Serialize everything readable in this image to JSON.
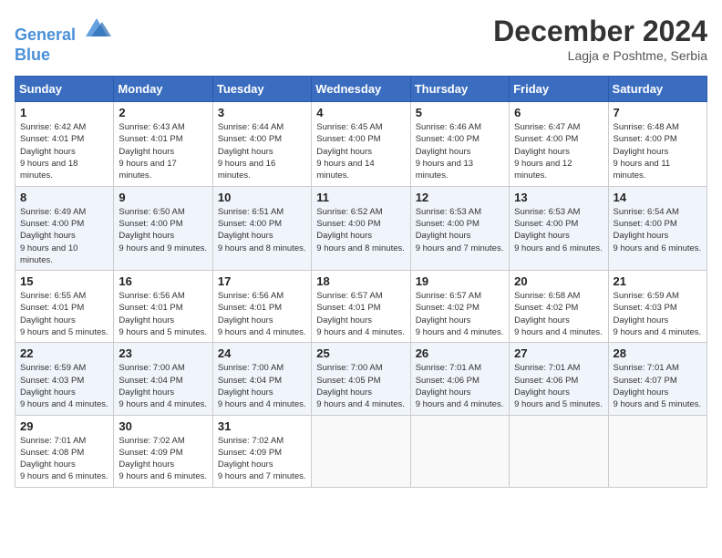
{
  "header": {
    "logo_line1": "General",
    "logo_line2": "Blue",
    "month_year": "December 2024",
    "location": "Lagja e Poshtme, Serbia"
  },
  "weekdays": [
    "Sunday",
    "Monday",
    "Tuesday",
    "Wednesday",
    "Thursday",
    "Friday",
    "Saturday"
  ],
  "weeks": [
    [
      {
        "day": "1",
        "sunrise": "6:42 AM",
        "sunset": "4:01 PM",
        "daylight": "9 hours and 18 minutes."
      },
      {
        "day": "2",
        "sunrise": "6:43 AM",
        "sunset": "4:01 PM",
        "daylight": "9 hours and 17 minutes."
      },
      {
        "day": "3",
        "sunrise": "6:44 AM",
        "sunset": "4:00 PM",
        "daylight": "9 hours and 16 minutes."
      },
      {
        "day": "4",
        "sunrise": "6:45 AM",
        "sunset": "4:00 PM",
        "daylight": "9 hours and 14 minutes."
      },
      {
        "day": "5",
        "sunrise": "6:46 AM",
        "sunset": "4:00 PM",
        "daylight": "9 hours and 13 minutes."
      },
      {
        "day": "6",
        "sunrise": "6:47 AM",
        "sunset": "4:00 PM",
        "daylight": "9 hours and 12 minutes."
      },
      {
        "day": "7",
        "sunrise": "6:48 AM",
        "sunset": "4:00 PM",
        "daylight": "9 hours and 11 minutes."
      }
    ],
    [
      {
        "day": "8",
        "sunrise": "6:49 AM",
        "sunset": "4:00 PM",
        "daylight": "9 hours and 10 minutes."
      },
      {
        "day": "9",
        "sunrise": "6:50 AM",
        "sunset": "4:00 PM",
        "daylight": "9 hours and 9 minutes."
      },
      {
        "day": "10",
        "sunrise": "6:51 AM",
        "sunset": "4:00 PM",
        "daylight": "9 hours and 8 minutes."
      },
      {
        "day": "11",
        "sunrise": "6:52 AM",
        "sunset": "4:00 PM",
        "daylight": "9 hours and 8 minutes."
      },
      {
        "day": "12",
        "sunrise": "6:53 AM",
        "sunset": "4:00 PM",
        "daylight": "9 hours and 7 minutes."
      },
      {
        "day": "13",
        "sunrise": "6:53 AM",
        "sunset": "4:00 PM",
        "daylight": "9 hours and 6 minutes."
      },
      {
        "day": "14",
        "sunrise": "6:54 AM",
        "sunset": "4:00 PM",
        "daylight": "9 hours and 6 minutes."
      }
    ],
    [
      {
        "day": "15",
        "sunrise": "6:55 AM",
        "sunset": "4:01 PM",
        "daylight": "9 hours and 5 minutes."
      },
      {
        "day": "16",
        "sunrise": "6:56 AM",
        "sunset": "4:01 PM",
        "daylight": "9 hours and 5 minutes."
      },
      {
        "day": "17",
        "sunrise": "6:56 AM",
        "sunset": "4:01 PM",
        "daylight": "9 hours and 4 minutes."
      },
      {
        "day": "18",
        "sunrise": "6:57 AM",
        "sunset": "4:01 PM",
        "daylight": "9 hours and 4 minutes."
      },
      {
        "day": "19",
        "sunrise": "6:57 AM",
        "sunset": "4:02 PM",
        "daylight": "9 hours and 4 minutes."
      },
      {
        "day": "20",
        "sunrise": "6:58 AM",
        "sunset": "4:02 PM",
        "daylight": "9 hours and 4 minutes."
      },
      {
        "day": "21",
        "sunrise": "6:59 AM",
        "sunset": "4:03 PM",
        "daylight": "9 hours and 4 minutes."
      }
    ],
    [
      {
        "day": "22",
        "sunrise": "6:59 AM",
        "sunset": "4:03 PM",
        "daylight": "9 hours and 4 minutes."
      },
      {
        "day": "23",
        "sunrise": "7:00 AM",
        "sunset": "4:04 PM",
        "daylight": "9 hours and 4 minutes."
      },
      {
        "day": "24",
        "sunrise": "7:00 AM",
        "sunset": "4:04 PM",
        "daylight": "9 hours and 4 minutes."
      },
      {
        "day": "25",
        "sunrise": "7:00 AM",
        "sunset": "4:05 PM",
        "daylight": "9 hours and 4 minutes."
      },
      {
        "day": "26",
        "sunrise": "7:01 AM",
        "sunset": "4:06 PM",
        "daylight": "9 hours and 4 minutes."
      },
      {
        "day": "27",
        "sunrise": "7:01 AM",
        "sunset": "4:06 PM",
        "daylight": "9 hours and 5 minutes."
      },
      {
        "day": "28",
        "sunrise": "7:01 AM",
        "sunset": "4:07 PM",
        "daylight": "9 hours and 5 minutes."
      }
    ],
    [
      {
        "day": "29",
        "sunrise": "7:01 AM",
        "sunset": "4:08 PM",
        "daylight": "9 hours and 6 minutes."
      },
      {
        "day": "30",
        "sunrise": "7:02 AM",
        "sunset": "4:09 PM",
        "daylight": "9 hours and 6 minutes."
      },
      {
        "day": "31",
        "sunrise": "7:02 AM",
        "sunset": "4:09 PM",
        "daylight": "9 hours and 7 minutes."
      },
      null,
      null,
      null,
      null
    ]
  ],
  "labels": {
    "sunrise": "Sunrise:",
    "sunset": "Sunset:",
    "daylight": "Daylight hours"
  }
}
